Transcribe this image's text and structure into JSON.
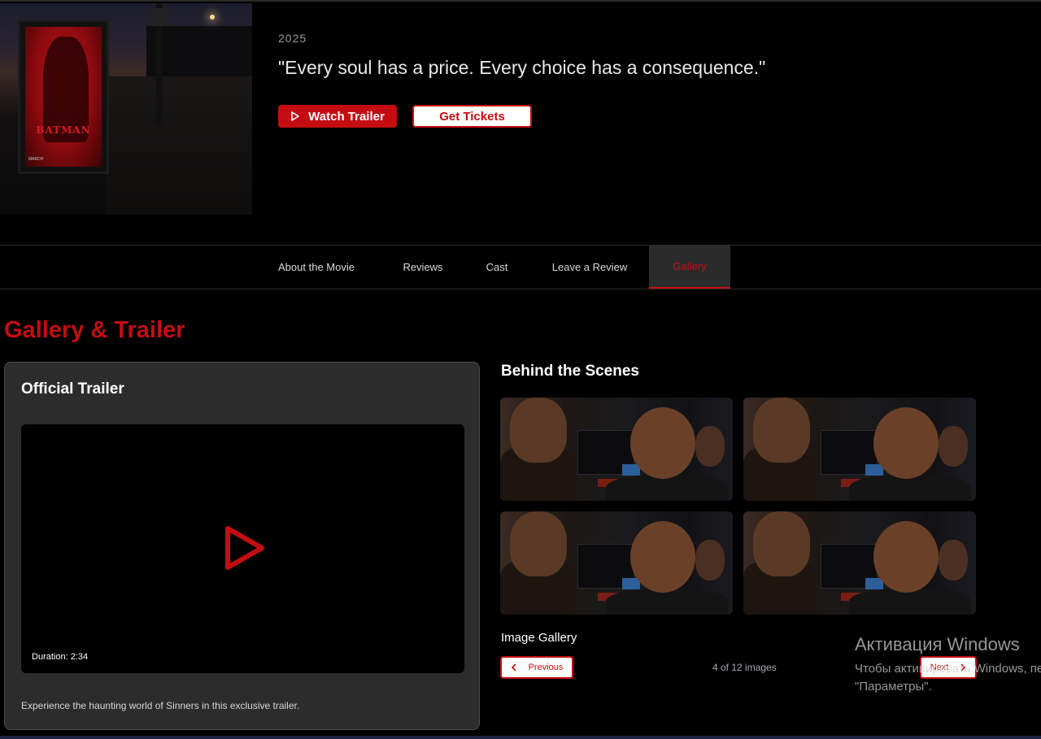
{
  "hero": {
    "year": "2025",
    "tagline": "\"Every soul has a price. Every choice has a consequence.\"",
    "watch_trailer_label": "Watch Trailer",
    "get_tickets_label": "Get Tickets",
    "poster_text": "BATMAN",
    "poster_footer": "MARCH"
  },
  "tabs": [
    {
      "label": "About the Movie"
    },
    {
      "label": "Reviews"
    },
    {
      "label": "Cast"
    },
    {
      "label": "Leave a Review"
    },
    {
      "label": "Gallery",
      "active": true
    }
  ],
  "section": {
    "title": "Gallery & Trailer"
  },
  "trailer": {
    "heading": "Official Trailer",
    "duration": "Duration: 2:34",
    "description": "Experience the haunting world of Sinners in this exclusive trailer."
  },
  "behind_scenes": {
    "heading": "Behind the Scenes",
    "thumbnails": 4
  },
  "gallery": {
    "label": "Image Gallery",
    "previous_label": "Previous",
    "next_label": "Next",
    "counter": "4 of 12 images"
  },
  "watermark": {
    "title": "Активация Windows",
    "line1": "Чтобы активировать Windows, перейдите в раздел",
    "line2": "\"Параметры\"."
  },
  "colors": {
    "accent": "#c40d12",
    "background": "#000000",
    "card": "#2c2c2c"
  },
  "icons": {
    "watch_trailer": "play-icon",
    "video": "play-icon",
    "previous": "chevron-left-icon",
    "next": "chevron-right-icon"
  }
}
